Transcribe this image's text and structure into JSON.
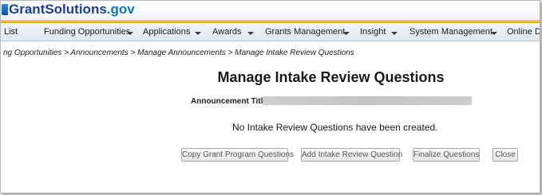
{
  "header": {
    "logo_brand": "GrantSolutions",
    "logo_tld": ".gov"
  },
  "nav": {
    "items": [
      {
        "label": "List",
        "has_caret": false
      },
      {
        "label": "Funding Opportunities",
        "has_caret": true
      },
      {
        "label": "Applications",
        "has_caret": true
      },
      {
        "label": "Awards",
        "has_caret": true
      },
      {
        "label": "Grants Management",
        "has_caret": true
      },
      {
        "label": "Insight",
        "has_caret": true
      },
      {
        "label": "System Management",
        "has_caret": true
      },
      {
        "label": "Online Dat",
        "has_caret": false
      }
    ]
  },
  "breadcrumb": "ng Opportunities > Announcements > Manage Announcements > Manage Intake Review Questions",
  "main": {
    "title": "Manage Intake Review Questions",
    "announcement_title_label": "Announcement Title:",
    "empty_message": "No Intake Review Questions have been created."
  },
  "buttons": {
    "copy": "Copy Grant Program Questions",
    "add": "Add Intake Review Question",
    "finalize": "Finalize Questions",
    "close": "Close"
  },
  "colors": {
    "brand": "#1d3f8f",
    "accent": "#0f74c8",
    "gold": "#e0b12a",
    "nav_bg": "#dfe7f2"
  }
}
